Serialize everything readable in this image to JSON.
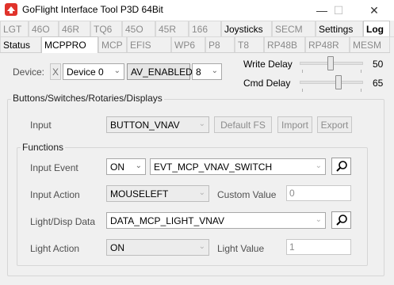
{
  "window": {
    "title": "GoFlight Interface Tool P3D 64Bit",
    "minimize_glyph": "—",
    "maximize_glyph": "☐",
    "close_glyph": "✕"
  },
  "tabs_row1": [
    "LGT",
    "46O",
    "46R",
    "TQ6",
    "45O",
    "45R",
    "166",
    "Joysticks",
    "SECM",
    "Settings",
    "Log"
  ],
  "tabs_row2": [
    "Status",
    "MCPPRO",
    "MCP",
    "EFIS",
    "WP6",
    "P8",
    "T8",
    "RP48B",
    "RP48R",
    "MESM"
  ],
  "device": {
    "label": "Device:",
    "x_button": "X",
    "device_select": "Device 0",
    "status_select": "AV_ENABLED",
    "index_select": "8",
    "arrow": "⌄"
  },
  "write_delay": {
    "label": "Write Delay",
    "value": "50",
    "level_pct": 50
  },
  "cmd_delay": {
    "label": "Cmd Delay",
    "value": "65",
    "level_pct": 65
  },
  "buttons_group": {
    "title": "Buttons/Switches/Rotaries/Displays",
    "input_label": "Input",
    "input_value": "BUTTON_VNAV",
    "default_fs": "Default FS",
    "import": "Import",
    "export": "Export"
  },
  "functions_group": {
    "title": "Functions",
    "input_event_label": "Input Event",
    "input_event_state": "ON",
    "input_event_value": "EVT_MCP_VNAV_SWITCH",
    "input_action_label": "Input Action",
    "input_action_value": "MOUSELEFT",
    "custom_value_label": "Custom Value",
    "custom_value": "0",
    "light_disp_label": "Light/Disp Data",
    "light_disp_value": "DATA_MCP_LIGHT_VNAV",
    "light_action_label": "Light Action",
    "light_action_value": "ON",
    "light_value_label": "Light Value",
    "light_value": "1"
  },
  "colors": {
    "window_bg": "#f0f0f0",
    "icon_red": "#e0332b"
  }
}
